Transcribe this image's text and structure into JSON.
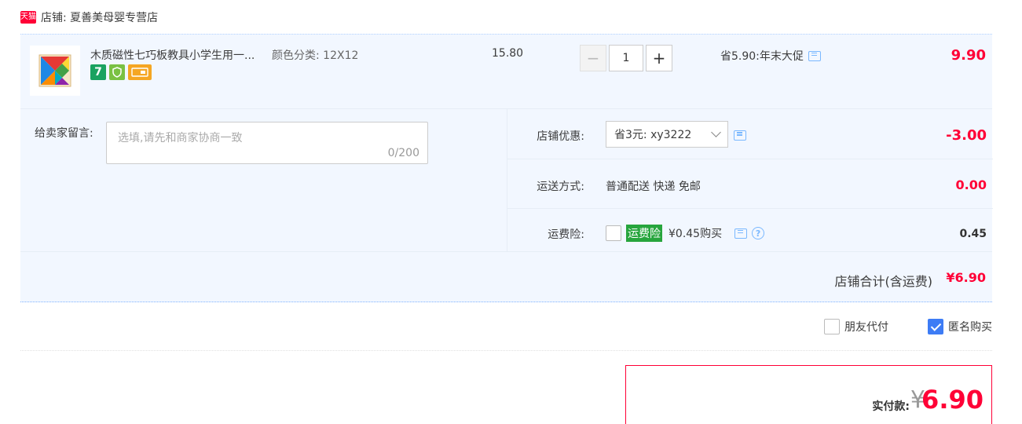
{
  "shop": {
    "badge": "天猫",
    "name": "店铺: 夏善美母婴专营店"
  },
  "item": {
    "title": "木质磁性七巧板教具小学生用一...",
    "sku": "颜色分类: 12X12",
    "unit_price": "15.80",
    "quantity": "1",
    "minus": "−",
    "plus": "+",
    "promo": "省5.90:年末大促",
    "total": "9.90",
    "icons": [
      "seven-day-return-icon",
      "shield-icon",
      "card-icon"
    ],
    "icon_seven": "7"
  },
  "message": {
    "label": "给卖家留言:",
    "placeholder": "选填,请先和商家协商一致",
    "counter": "0/200"
  },
  "coupon": {
    "label": "店铺优惠:",
    "selected": "省3元: xy3222",
    "amount": "-3.00"
  },
  "shipping": {
    "label": "运送方式:",
    "method": "普通配送 快递 免邮",
    "amount": "0.00"
  },
  "insurance": {
    "label": "运费险:",
    "tag": "运费险",
    "price": "¥0.45购买",
    "amount": "0.45",
    "help": "?"
  },
  "subtotal": {
    "label": "店铺合计(含运费)",
    "amount": "¥6.90"
  },
  "options": {
    "friend_pay": "朋友代付",
    "anonymous": "匿名购买"
  },
  "payment": {
    "label": "实付款:",
    "currency": "¥",
    "amount": "6.90"
  },
  "colors": {
    "accent": "#ff0036",
    "panel": "#f2f7ff",
    "checkbox": "#3d7cf5"
  }
}
